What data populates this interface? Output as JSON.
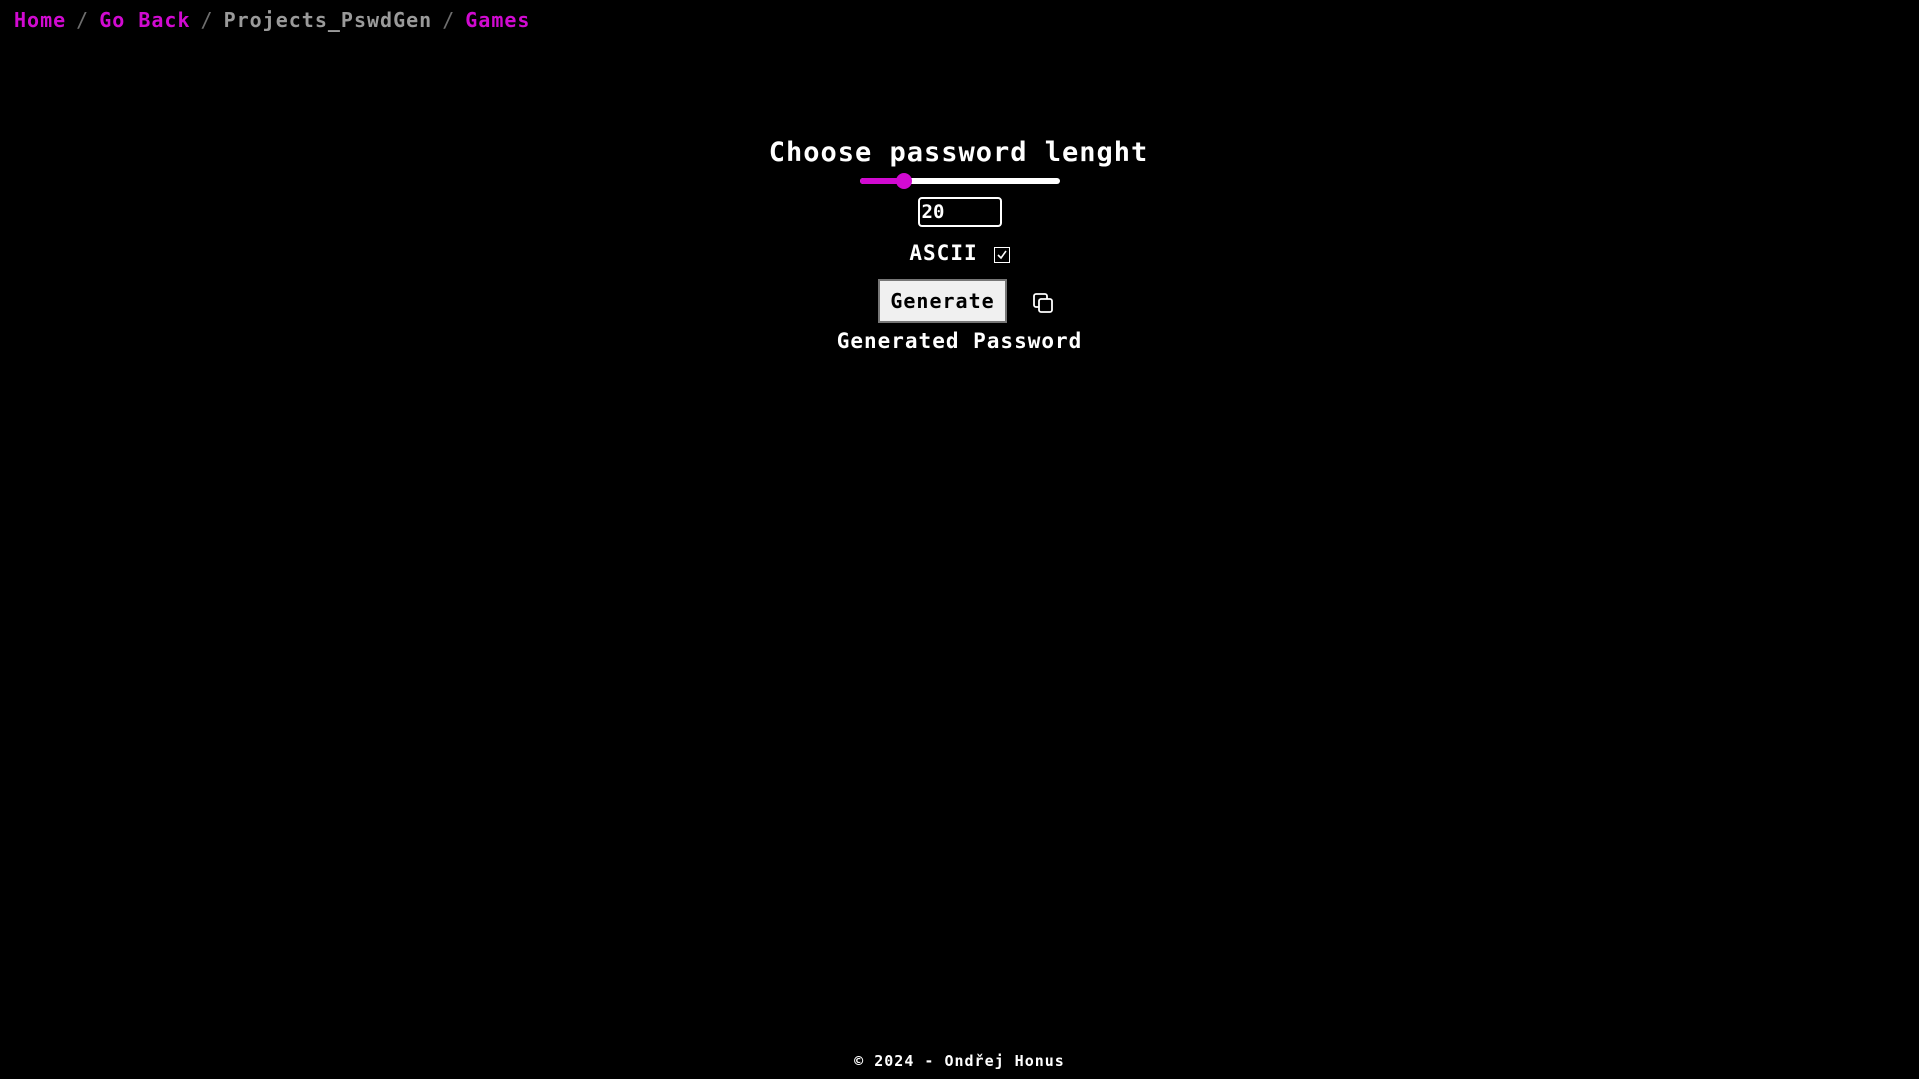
{
  "breadcrumb": {
    "home": "Home",
    "go_back": "Go Back",
    "current": "Projects_PswdGen",
    "games": "Games",
    "separator": "/"
  },
  "main": {
    "title": "Choose password lenght",
    "slider_fraction": 0.22,
    "length_value": "20",
    "ascii_label": "ASCII",
    "ascii_checked": true,
    "generate_label": "Generate",
    "copy_icon": "copy-icon",
    "generated_text": "Generated Password"
  },
  "footer": {
    "text": "© 2024 - Ondřej Honus"
  },
  "colors": {
    "accent": "#d10ad1",
    "background": "#000000",
    "text": "#ffffff",
    "muted": "#9a9a9a"
  }
}
